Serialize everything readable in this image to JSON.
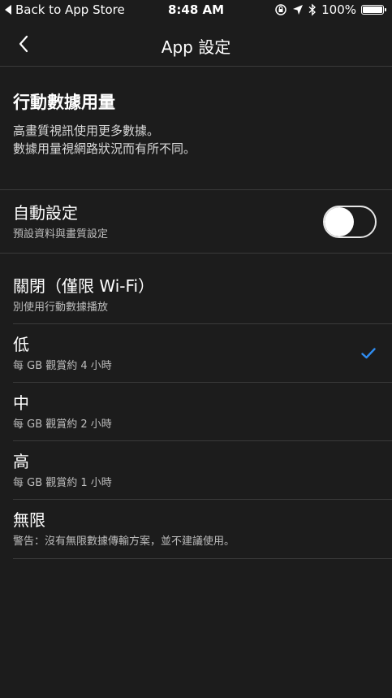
{
  "status_bar": {
    "back_label": "Back to App Store",
    "time": "8:48 AM",
    "battery": "100%",
    "battery_level": 1.0
  },
  "nav": {
    "title": "App 設定",
    "back_icon": "chevron-left-icon"
  },
  "section": {
    "title": "行動數據用量",
    "desc_line1": "高畫質視訊使用更多數據。",
    "desc_line2": "數據用量視網路狀況而有所不同。"
  },
  "auto": {
    "label": "自動設定",
    "sub": "預設資料與畫質設定",
    "enabled": false
  },
  "options": [
    {
      "label": "關閉（僅限 Wi-Fi）",
      "sub": "別使用行動數據播放",
      "selected": false
    },
    {
      "label": "低",
      "sub": "每 GB 觀賞約 4 小時",
      "selected": true
    },
    {
      "label": "中",
      "sub": "每 GB 觀賞約 2 小時",
      "selected": false
    },
    {
      "label": "高",
      "sub": "每 GB 觀賞約 1 小時",
      "selected": false
    },
    {
      "label": "無限",
      "sub": "警告：沒有無限數據傳輸方案，並不建議使用。",
      "selected": false
    }
  ],
  "colors": {
    "background": "#1c1c1c",
    "accent": "#2f8cf0",
    "divider": "#3a3a3a"
  }
}
